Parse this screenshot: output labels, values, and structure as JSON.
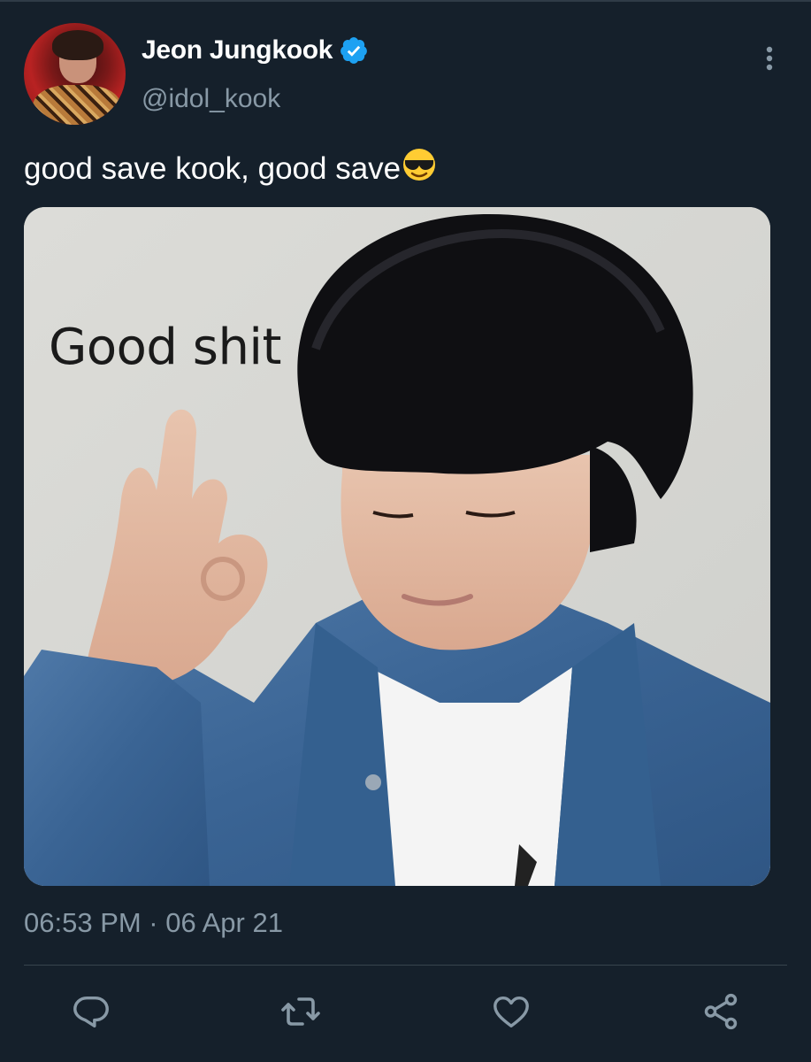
{
  "tweet": {
    "display_name": "Jeon Jungkook",
    "handle": "@idol_kook",
    "text": "good save kook, good save",
    "emoji": "smiling-face-with-sunglasses",
    "timestamp": "06:53 PM · 06 Apr 21",
    "media": {
      "caption": "Good shit"
    }
  },
  "icons": {
    "verified": "verified-badge-icon",
    "more": "more-vertical-icon",
    "reply": "reply-icon",
    "retweet": "retweet-icon",
    "like": "heart-icon",
    "share": "share-icon"
  },
  "colors": {
    "background": "#15202b",
    "secondary_text": "#8899a6",
    "verified": "#1da1f2",
    "divider": "#38444d"
  }
}
